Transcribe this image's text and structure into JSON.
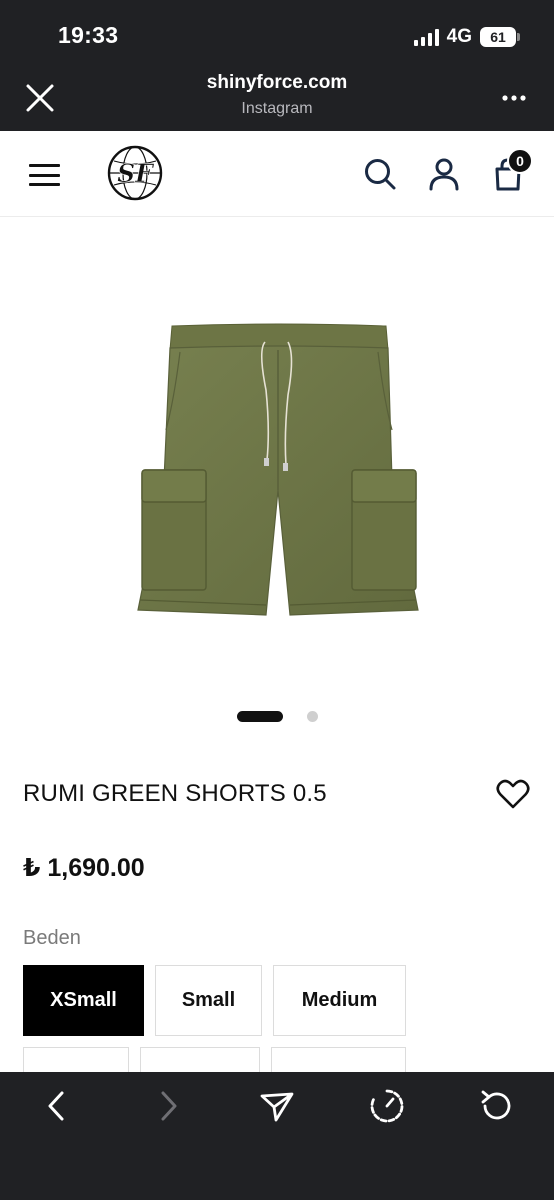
{
  "status_bar": {
    "time": "19:33",
    "network": "4G",
    "battery": "61"
  },
  "browser": {
    "domain": "shinyforce.com",
    "source": "Instagram",
    "icons": {
      "close": "close-icon",
      "more": "more-dots-icon"
    }
  },
  "site_header": {
    "logo_text": "SF",
    "cart_count": "0",
    "icons": [
      "menu-icon",
      "search-icon",
      "account-icon",
      "cart-icon"
    ]
  },
  "product": {
    "name": "RUMI GREEN SHORTS 0.5",
    "price": "₺ 1,690.00",
    "size_label": "Beden",
    "sizes": [
      "XSmall",
      "Small",
      "Medium"
    ],
    "selected_size": "XSmall",
    "image_color": "#6f7748",
    "gallery_total": 2,
    "gallery_active": 1
  },
  "toolbar": {
    "icons": [
      "back-icon",
      "forward-icon",
      "share-icon",
      "speed-icon",
      "reload-icon"
    ]
  }
}
